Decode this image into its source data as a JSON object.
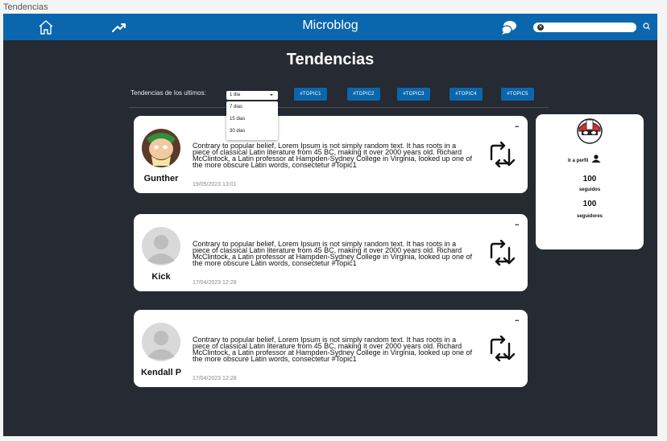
{
  "window": {
    "title": "Tendencias"
  },
  "header": {
    "app_title": "Microblog",
    "search": {
      "value": "",
      "placeholder": ""
    }
  },
  "page": {
    "title": "Tendencias"
  },
  "filter": {
    "label": "Tendencias de los ultimos:",
    "selected": "1 dia",
    "options": [
      "7 dias",
      "15 dias",
      "30 dias"
    ]
  },
  "topics": [
    "#TOPIC1",
    "#TOPIC2",
    "#TOPIC3",
    "#TOPIC4",
    "#TOPIC5"
  ],
  "posts": [
    {
      "user": "Gunther",
      "text": "Contrary to popular belief, Lorem Ipsum is not simply random text. It has roots in a piece of classical Latin literature from 45 BC, making it over 2000 years old. Richard McClintock, a Latin professor at Hampden-Sydney College in Virginia, looked up one of the more obscure Latin words, consectetur #Topic1",
      "date": "19/05/2023 13:01",
      "menu": "..."
    },
    {
      "user": "Kick",
      "text": "Contrary to popular belief, Lorem Ipsum is not simply random text. It has roots in a piece of classical Latin literature from 45 BC, making it over 2000 years old. Richard McClintock, a Latin professor at Hampden-Sydney College in Virginia, looked up one of the more obscure Latin words, consectetur #Topic1",
      "date": "17/04/2023 12:28",
      "menu": "..."
    },
    {
      "user": "Kendall P",
      "text": "Contrary to popular belief, Lorem Ipsum is not simply random text. It has roots in a piece of classical Latin literature from 45 BC, making it over 2000 years old. Richard McClintock, a Latin professor at Hampden-Sydney College in Virginia, looked up one of the more obscure Latin words, consectetur #Topic1",
      "date": "17/04/2023 12:28",
      "menu": "..."
    }
  ],
  "profile_card": {
    "link_label": "Ir a perfil",
    "following_count": "100",
    "following_label": "seguidos",
    "followers_count": "100",
    "followers_label": "seguidores"
  },
  "colors": {
    "topbar": "#0b67ad",
    "background": "#252a33",
    "card": "#ffffff",
    "topic_chip": "#0b67ad"
  },
  "icons": [
    "home-icon",
    "trending-icon",
    "chat-icon",
    "search-icon",
    "clear-icon",
    "retweet-icon",
    "user-icon",
    "more-icon"
  ]
}
